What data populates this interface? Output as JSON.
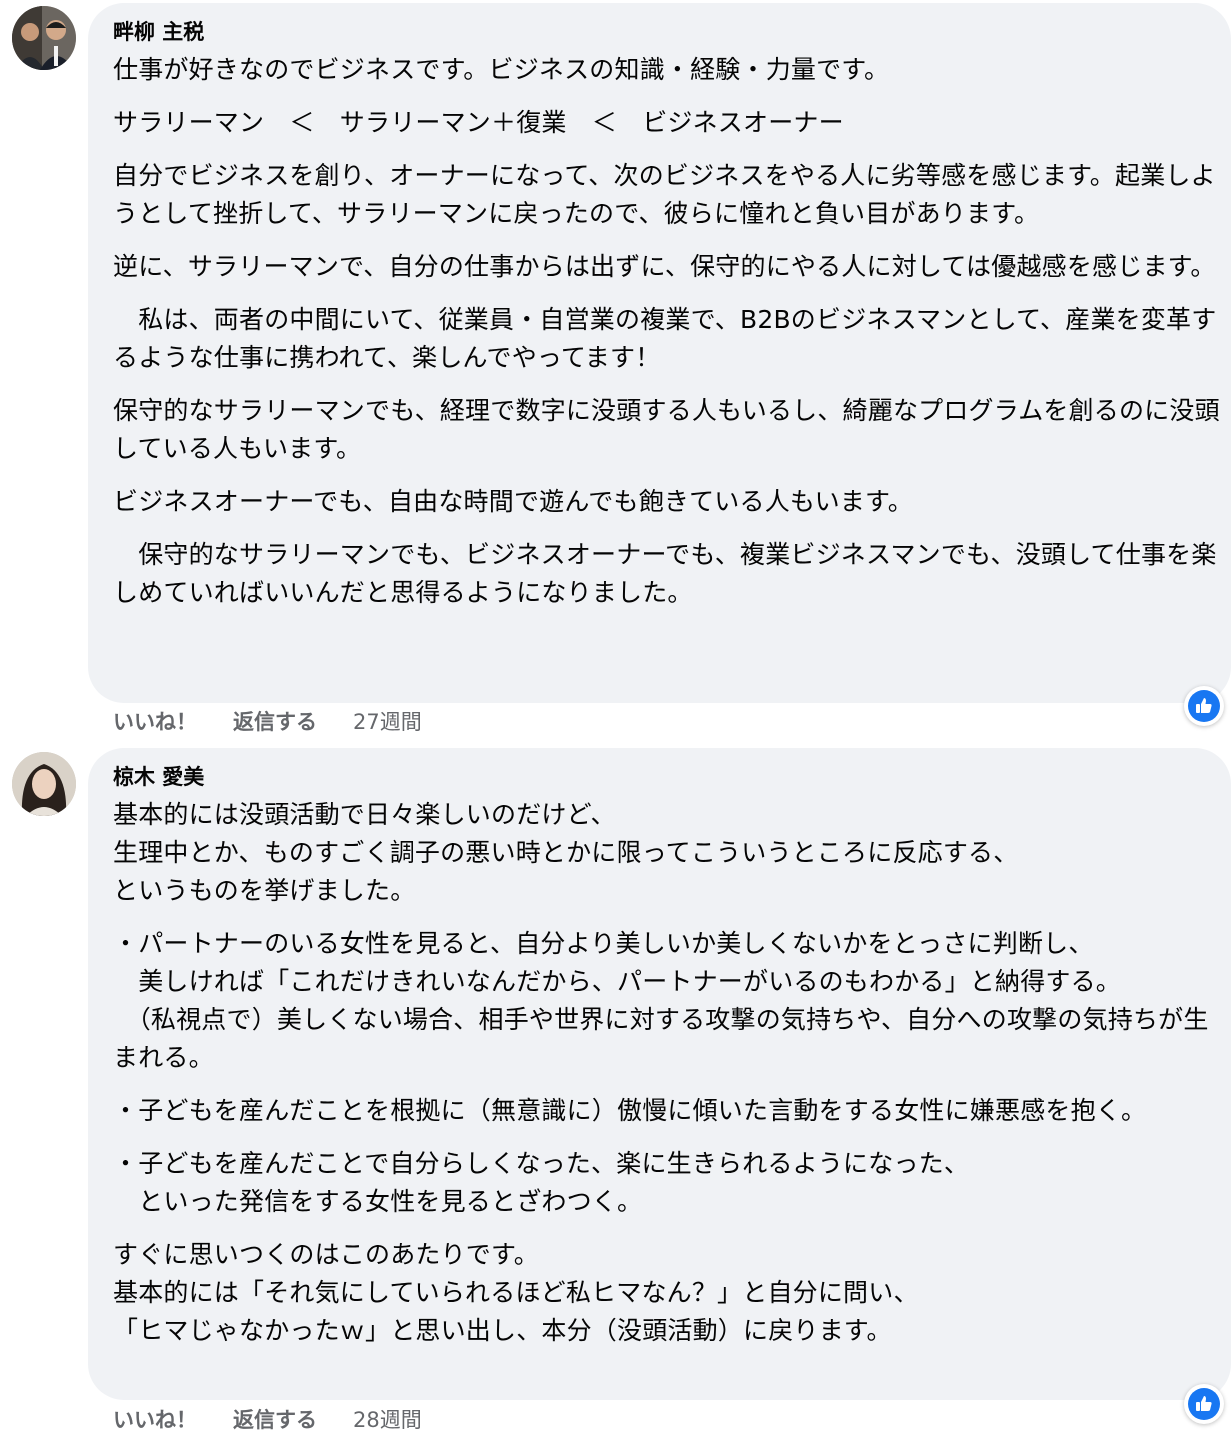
{
  "actions": {
    "like": "いいね！",
    "reply": "返信する"
  },
  "comments": [
    {
      "author": "畔柳 主税",
      "time": "27週間",
      "paragraphs": [
        "仕事が好きなのでビジネスです。ビジネスの知識・経験・力量です。",
        "サラリーマン　＜　サラリーマン＋復業　＜　ビジネスオーナー",
        "自分でビジネスを創り、オーナーになって、次のビジネスをやる人に劣等感を感じます。起業しようとして挫折して、サラリーマンに戻ったので、彼らに憧れと負い目があります。",
        "逆に、サラリーマンで、自分の仕事からは出ずに、保守的にやる人に対しては優越感を感じます。",
        "　私は、両者の中間にいて、従業員・自営業の複業で、B2Bのビジネスマンとして、産業を変革するような仕事に携われて、楽しんでやってます！",
        "保守的なサラリーマンでも、経理で数字に没頭する人もいるし、綺麗なプログラムを創るのに没頭している人もいます。",
        "ビジネスオーナーでも、自由な時間で遊んでも飽きている人もいます。",
        "　保守的なサラリーマンでも、ビジネスオーナーでも、複業ビジネスマンでも、没頭して仕事を楽しめていればいいんだと思得るようになりました。"
      ]
    },
    {
      "author": "椋木 愛美",
      "time": "28週間",
      "paragraphs": [
        "基本的には没頭活動で日々楽しいのだけど、\n生理中とか、ものすごく調子の悪い時とかに限ってこういうところに反応する、\nというものを挙げました。",
        "・パートナーのいる女性を見ると、自分より美しいか美しくないかをとっさに判断し、\n　美しければ「これだけきれいなんだから、パートナーがいるのもわかる」と納得する。\n　（私視点で）美しくない場合、相手や世界に対する攻撃の気持ちや、自分への攻撃の気持ちが生まれる。",
        "・子どもを産んだことを根拠に（無意識に）傲慢に傾いた言動をする女性に嫌悪感を抱く。",
        "・子どもを産んだことで自分らしくなった、楽に生きられるようになった、\n　といった発信をする女性を見るとざわつく。",
        "すぐに思いつくのはこのあたりです。\n基本的には「それ気にしていられるほど私ヒマなん？」と自分に問い、\n「ヒマじゃなかったｗ」と思い出し、本分（没頭活動）に戻ります。"
      ]
    }
  ]
}
